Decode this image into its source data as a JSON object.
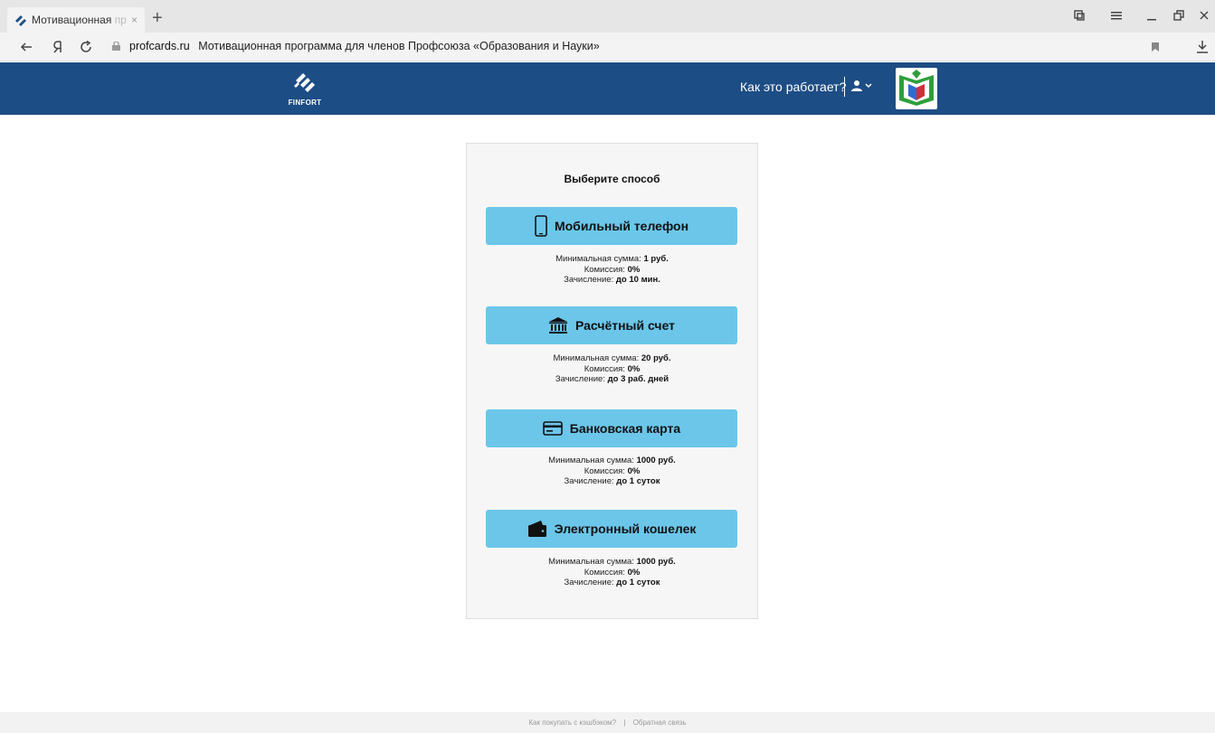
{
  "browser": {
    "tab_title": "Мотивационная",
    "tab_title_fade": "пр...",
    "close_glyph": "×",
    "new_tab_glyph": "+",
    "url_host": "profcards.ru",
    "url_page_title": "Мотивационная программа для членов Профсоюза «Образования и Науки»"
  },
  "header": {
    "logo_text": "FINFORT",
    "how_it_works": "Как это работает?",
    "brand_color": "#1d4d85"
  },
  "card": {
    "title": "Выберите способ",
    "methods": [
      {
        "label": "Мобильный телефон",
        "icon": "mobile-phone-icon",
        "min_label": "Минимальная сумма: ",
        "min_value": "1 руб.",
        "fee_label": "Комиссия: ",
        "fee_value": "0%",
        "time_label": "Зачисление: ",
        "time_value": "до 10 мин."
      },
      {
        "label": "Расчётный счет",
        "icon": "bank-icon",
        "min_label": "Минимальная сумма: ",
        "min_value": "20 руб.",
        "fee_label": "Комиссия: ",
        "fee_value": "0%",
        "time_label": "Зачисление: ",
        "time_value": "до 3 раб. дней"
      },
      {
        "label": "Банковская карта",
        "icon": "credit-card-icon",
        "min_label": "Минимальная сумма: ",
        "min_value": "1000 руб.",
        "fee_label": "Комиссия: ",
        "fee_value": "0%",
        "time_label": "Зачисление: ",
        "time_value": "до 1 суток"
      },
      {
        "label": "Электронный кошелек",
        "icon": "wallet-icon",
        "min_label": "Минимальная сумма: ",
        "min_value": "1000 руб.",
        "fee_label": "Комиссия: ",
        "fee_value": "0%",
        "time_label": "Зачисление: ",
        "time_value": "до 1 суток"
      }
    ],
    "button_color": "#6bc6ea"
  },
  "footer": {
    "link1": "Как покупать с кэшбэком?",
    "divider": "|",
    "link2": "Обратная связь"
  }
}
